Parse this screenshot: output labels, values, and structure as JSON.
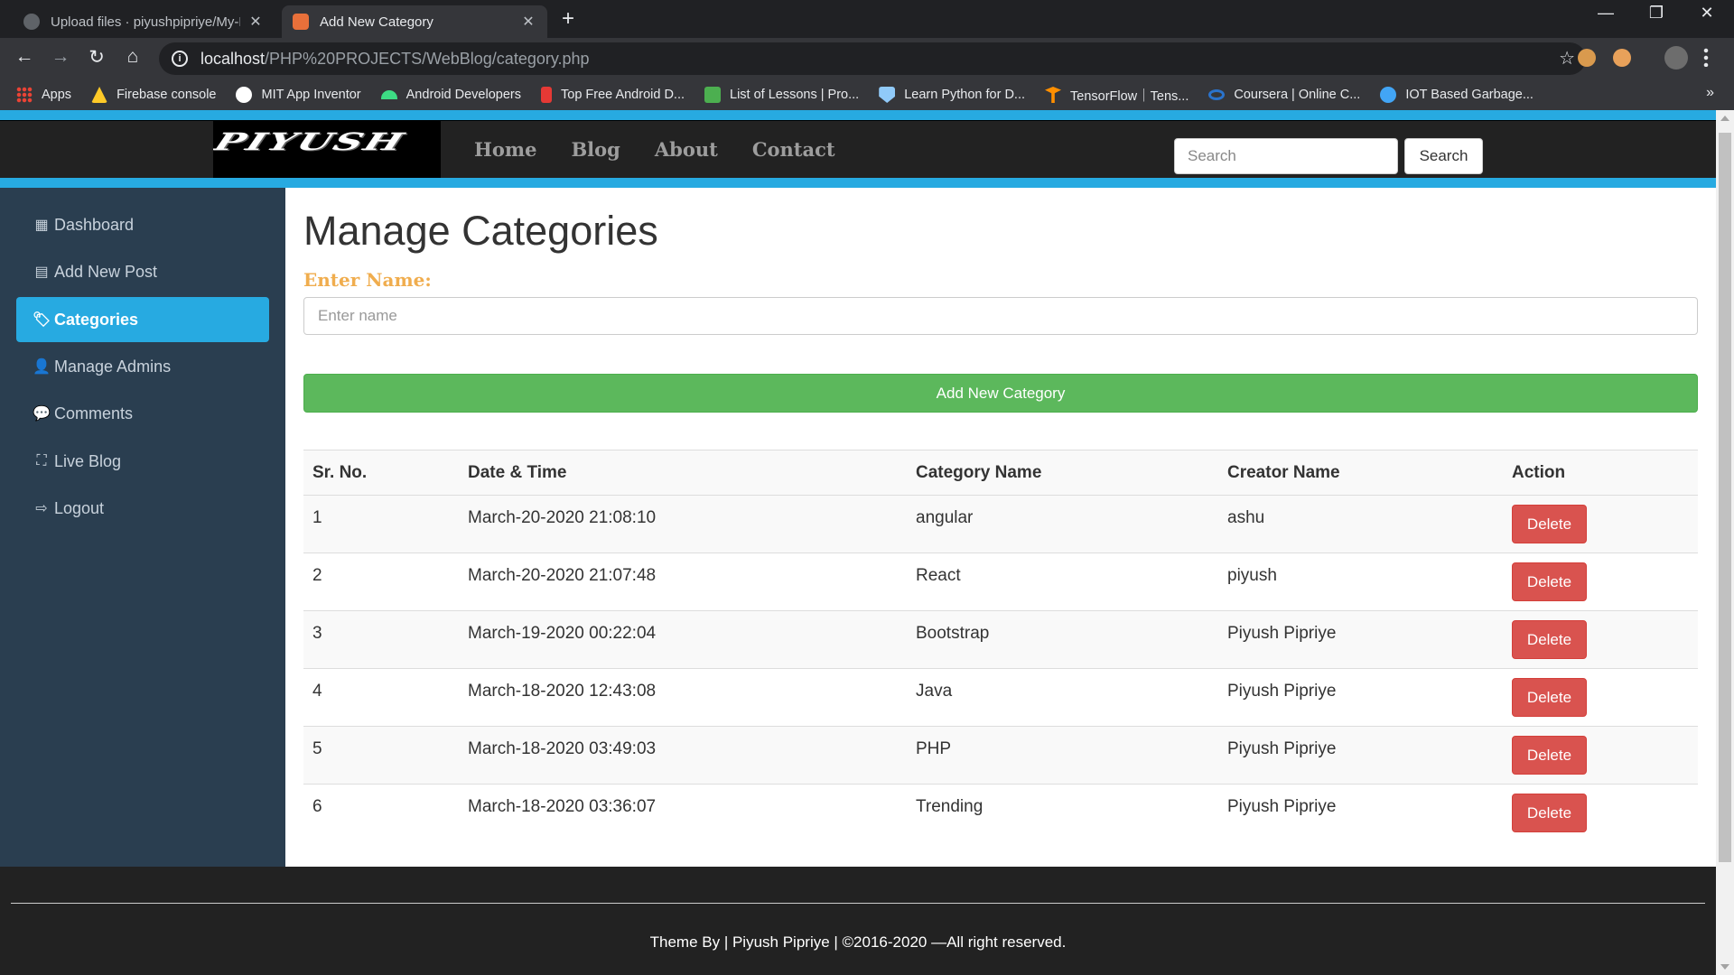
{
  "browser": {
    "tabs": [
      {
        "title": "Upload files · piyushpipriye/My-Bl",
        "active": false
      },
      {
        "title": "Add New Category",
        "active": true
      }
    ],
    "new_tab": "+",
    "window_controls": {
      "minimize": "—",
      "restore": "❐",
      "close": "✕"
    },
    "nav": {
      "back": "←",
      "forward": "→",
      "reload": "↻",
      "home": "⌂"
    },
    "address": {
      "host": "localhost",
      "path": "/PHP%20PROJECTS/WebBlog/category.php"
    },
    "bookmarks": [
      {
        "label": "Apps",
        "color": "#ea4335"
      },
      {
        "label": "Firebase console",
        "color": "#ffca28"
      },
      {
        "label": "MIT App Inventor",
        "color": "#ffffff"
      },
      {
        "label": "Android Developers",
        "color": "#3ddc84"
      },
      {
        "label": "Top Free Android D...",
        "color": "#e53935"
      },
      {
        "label": "List of Lessons | Pro...",
        "color": "#4caf50"
      },
      {
        "label": "Learn Python for D...",
        "color": "#90caf9"
      },
      {
        "label": "TensorFlow｜Tens...",
        "color": "#ff8f00"
      },
      {
        "label": "Coursera | Online C...",
        "color": "#2a73cc"
      },
      {
        "label": "IOT Based Garbage...",
        "color": "#42a5f5"
      }
    ],
    "bookmarks_more": "»"
  },
  "site": {
    "logo_text": "PIYUSH",
    "menu": [
      "Home",
      "Blog",
      "About",
      "Contact"
    ],
    "search_placeholder": "Search",
    "search_button": "Search"
  },
  "sidebar": {
    "items": [
      {
        "label": "Dashboard",
        "icon": "grid-icon",
        "glyph": "▦",
        "active": false
      },
      {
        "label": "Add New Post",
        "icon": "list-icon",
        "glyph": "▤",
        "active": false
      },
      {
        "label": "Categories",
        "icon": "tags-icon",
        "glyph": "🏷",
        "active": true
      },
      {
        "label": "Manage Admins",
        "icon": "user-icon",
        "glyph": "👤",
        "active": false
      },
      {
        "label": "Comments",
        "icon": "comment-icon",
        "glyph": "💬",
        "active": false
      },
      {
        "label": "Live Blog",
        "icon": "sitemap-icon",
        "glyph": "⛶",
        "active": false
      },
      {
        "label": "Logout",
        "icon": "logout-icon",
        "glyph": "⇨",
        "active": false
      }
    ]
  },
  "main": {
    "title": "Manage Categories",
    "name_label": "Enter Name:",
    "name_placeholder": "Enter name",
    "add_button": "Add New Category",
    "table": {
      "headers": [
        "Sr. No.",
        "Date & Time",
        "Category Name",
        "Creator Name",
        "Action"
      ],
      "rows": [
        {
          "sr": "1",
          "datetime": "March-20-2020 21:08:10",
          "category": "angular",
          "creator": "ashu",
          "action": "Delete"
        },
        {
          "sr": "2",
          "datetime": "March-20-2020 21:07:48",
          "category": "React",
          "creator": "piyush",
          "action": "Delete"
        },
        {
          "sr": "3",
          "datetime": "March-19-2020 00:22:04",
          "category": "Bootstrap",
          "creator": "Piyush Pipriye",
          "action": "Delete"
        },
        {
          "sr": "4",
          "datetime": "March-18-2020 12:43:08",
          "category": "Java",
          "creator": "Piyush Pipriye",
          "action": "Delete"
        },
        {
          "sr": "5",
          "datetime": "March-18-2020 03:49:03",
          "category": "PHP",
          "creator": "Piyush Pipriye",
          "action": "Delete"
        },
        {
          "sr": "6",
          "datetime": "March-18-2020 03:36:07",
          "category": "Trending",
          "creator": "Piyush Pipriye",
          "action": "Delete"
        }
      ]
    }
  },
  "footer": {
    "text": "Theme By | Piyush Pipriye | ©2016-2020 —All right reserved."
  },
  "colors": {
    "accent_blue": "#27aae1",
    "sidebar_bg": "#2a3e50",
    "success_green": "#5cb85c",
    "danger_red": "#d9534f",
    "label_orange": "#f0ad4e"
  }
}
